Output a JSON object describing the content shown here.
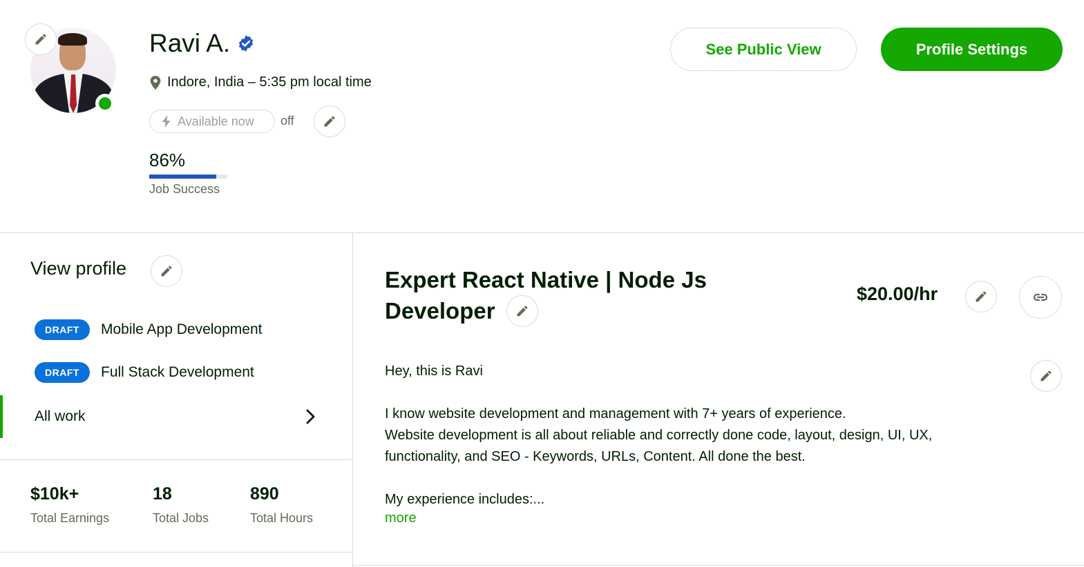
{
  "colors": {
    "brand_green": "#14a800",
    "badge_blue": "#0c70da",
    "progress_blue": "#1f57c3",
    "online": "#14a800"
  },
  "header": {
    "name": "Ravi A.",
    "location": "Indore, India – 5:35 pm local time",
    "availability": {
      "label": "Available now",
      "state": "off"
    },
    "job_success": {
      "value": "86%",
      "percent": 86,
      "label": "Job Success"
    },
    "buttons": {
      "public_view": "See Public View",
      "settings": "Profile Settings"
    }
  },
  "sidebar": {
    "heading": "View profile",
    "specialized_profiles": [
      {
        "badge": "DRAFT",
        "label": "Mobile App Development"
      },
      {
        "badge": "DRAFT",
        "label": "Full Stack Development"
      }
    ],
    "all_work": "All work",
    "stats": [
      {
        "value": "$10k+",
        "label": "Total Earnings"
      },
      {
        "value": "18",
        "label": "Total Jobs"
      },
      {
        "value": "890",
        "label": "Total Hours"
      }
    ]
  },
  "main": {
    "title_line1": "Expert React Native | Node Js",
    "title_line2": "Developer",
    "rate": "$20.00/hr",
    "bio": {
      "greeting": "Hey, this is Ravi",
      "line1": "I know website development and management with 7+ years of experience.",
      "line2": "Website development is all about reliable and correctly done code, layout, design, UI, UX,",
      "line3": "functionality, and SEO - Keywords, URLs, Content. All done the best.",
      "line4": "My experience includes:..."
    },
    "more": "more"
  },
  "icons": {
    "edit": "pencil-icon",
    "verified": "verified-badge-icon",
    "location": "location-pin-icon",
    "availability": "lightning-icon",
    "link": "link-icon",
    "chevron": "chevron-right-icon"
  }
}
